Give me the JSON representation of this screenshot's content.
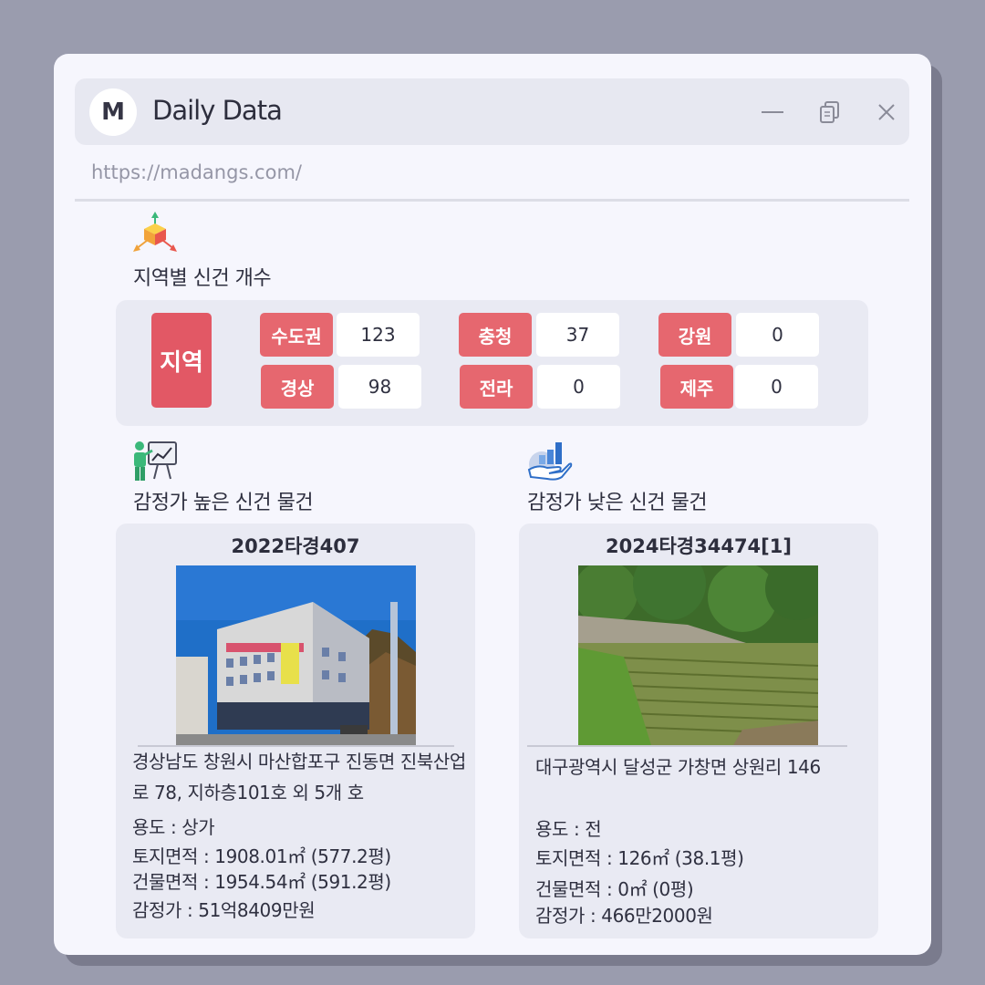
{
  "window": {
    "avatar_letter": "M",
    "title": "Daily Data",
    "url": "https://madangs.com/"
  },
  "icons": {
    "minimize": "minimize-icon",
    "restore": "restore-icon",
    "close": "close-icon",
    "region_section": "cube-axes-icon",
    "high_section": "presentation-chart-icon",
    "low_section": "hand-chart-icon"
  },
  "region_section": {
    "title": "지역별 신건 개수",
    "main_label": "지역",
    "regions": [
      {
        "name": "수도권",
        "count": "123"
      },
      {
        "name": "경상",
        "count": "98"
      },
      {
        "name": "충청",
        "count": "37"
      },
      {
        "name": "전라",
        "count": "0"
      },
      {
        "name": "강원",
        "count": "0"
      },
      {
        "name": "제주",
        "count": "0"
      }
    ]
  },
  "high_section": {
    "title": "감정가 높은 신건 물건",
    "case_no": "2022타경407",
    "address": "경상남도 창원시 마산합포구 진동면 진북산업로 78, 지하층101호 외 5개 호",
    "usage": "용도 : 상가",
    "land_area": "토지면적 : 1908.01㎡ (577.2평)",
    "building_area": "건물면적 : 1954.54㎡ (591.2평)",
    "appraisal": "감정가 : 51억8409만원"
  },
  "low_section": {
    "title": "감정가 낮은 신건 물건",
    "case_no": "2024타경34474[1]",
    "address": "대구광역시 달성군 가창면 상원리 146",
    "usage": "용도 : 전",
    "land_area": "토지면적 : 126㎡ (38.1평)",
    "building_area": "건물면적 : 0㎡ (0평)",
    "appraisal": "감정가 : 466만2000원"
  },
  "colors": {
    "background": "#9a9cae",
    "window": "#f6f6fd",
    "panel": "#e9eaf3",
    "accent_red": "#e25865",
    "tag_red": "#e6676f"
  }
}
